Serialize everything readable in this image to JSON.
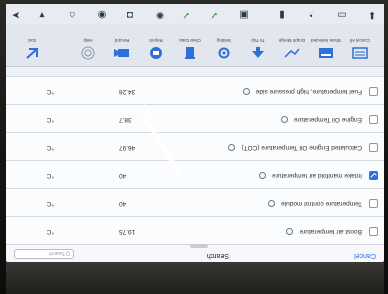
{
  "header": {
    "cancel_label": "Cancel",
    "title": "Search",
    "search_placeholder": "Q Search"
  },
  "rows": [
    {
      "name": "Boost air temperature",
      "value": "19.75",
      "unit": "°C",
      "checked": false
    },
    {
      "name": "Temperature control module",
      "value": "40",
      "unit": "°C",
      "checked": false
    },
    {
      "name": "Intake manifold air temperature",
      "value": "40",
      "unit": "°C",
      "checked": true
    },
    {
      "name": "Calculated Engine Oil Temperature (COT)",
      "value": "46.97",
      "unit": "°C",
      "checked": false
    },
    {
      "name": "Engine Oil Temperature",
      "value": "38.7",
      "unit": "°C",
      "checked": false
    },
    {
      "name": "Fuel temperature, high pressure side",
      "value": "34.28",
      "unit": "°C",
      "checked": false
    }
  ],
  "toolbar": {
    "items": [
      {
        "label": "Cancel All",
        "icon": "list-icon"
      },
      {
        "label": "Show Selected",
        "icon": "select-icon"
      },
      {
        "label": "Graph Merge",
        "icon": "graph-icon"
      },
      {
        "label": "To Top",
        "icon": "arrow-up-icon"
      },
      {
        "label": "Setting",
        "icon": "gear-icon"
      },
      {
        "label": "Clear Data",
        "icon": "trash-icon"
      },
      {
        "label": "Report",
        "icon": "report-icon"
      },
      {
        "label": "Record",
        "icon": "record-icon"
      },
      {
        "label": "Help",
        "icon": "help-icon"
      },
      {
        "label": "Exit",
        "icon": "exit-icon"
      }
    ]
  },
  "colors": {
    "accent": "#2e6fd8",
    "background": "#eef1f6",
    "toolbar": "#e2e6ee"
  }
}
